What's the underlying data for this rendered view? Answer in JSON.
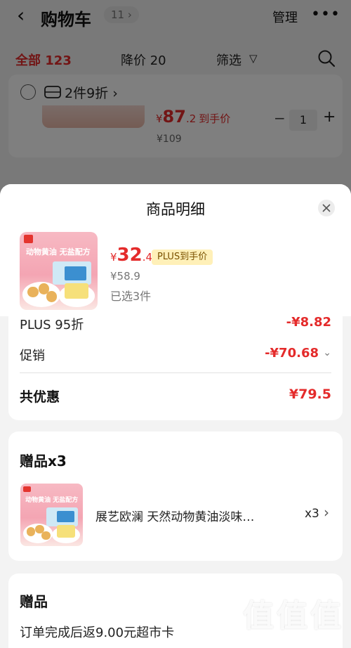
{
  "background_page": {
    "title": "购物车",
    "count": "11",
    "manage": "管理",
    "tabs": {
      "all": "全部 123",
      "price_drop": "降价 20",
      "filter": "筛选"
    },
    "cart_item": {
      "promo": "2件9折",
      "price_symbol": "¥",
      "price_int": "87",
      "price_dec": ".2",
      "price_label": "到手价",
      "original_price": "¥109",
      "quantity": "1"
    }
  },
  "sheet": {
    "title": "商品明细",
    "product": {
      "image_text": "动物黄油 无盐配方",
      "price_symbol": "¥",
      "price_int": "32",
      "price_dec": ".4",
      "plus_tag": "PLUS到手价",
      "original_price": "¥58.9",
      "selected": "已选3件"
    },
    "discounts": [
      {
        "label": "PLUS 95折",
        "value": "-¥8.82"
      },
      {
        "label": "促销",
        "value": "-¥70.68"
      }
    ],
    "total": {
      "label": "共优惠",
      "value": "¥79.5"
    },
    "gift": {
      "title": "赠品x3",
      "name": "展艺欧澜 天然动物黄油淡味…",
      "quantity": "x3"
    },
    "gift2": {
      "title": "赠品",
      "desc": "订单完成后返9.00元超市卡"
    }
  },
  "watermark": {
    "chars": "值值值",
    "url": "zhizhizhi.com"
  },
  "colors": {
    "accent_red": "#e42b2b",
    "plus_tag_bg": "#fff0b8",
    "sheet_bg": "#f3f3f3"
  }
}
